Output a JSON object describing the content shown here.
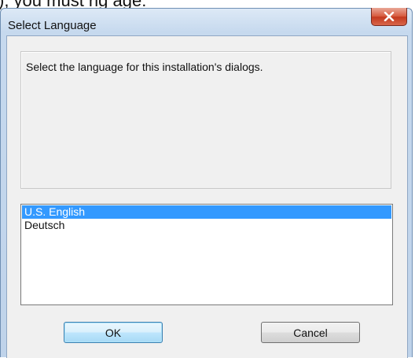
{
  "background_text": "),    you must rig     age:",
  "window": {
    "title": "Select Language",
    "close_label": "X"
  },
  "message": "Select the language for this installation's dialogs.",
  "languages": [
    {
      "label": "U.S. English",
      "selected": true
    },
    {
      "label": "Deutsch",
      "selected": false
    }
  ],
  "buttons": {
    "ok": "OK",
    "cancel": "Cancel"
  },
  "colors": {
    "selection": "#3399ff",
    "close_button": "#c7432a",
    "titlebar": "#c6d9ee"
  },
  "icons": [
    "close-icon"
  ]
}
